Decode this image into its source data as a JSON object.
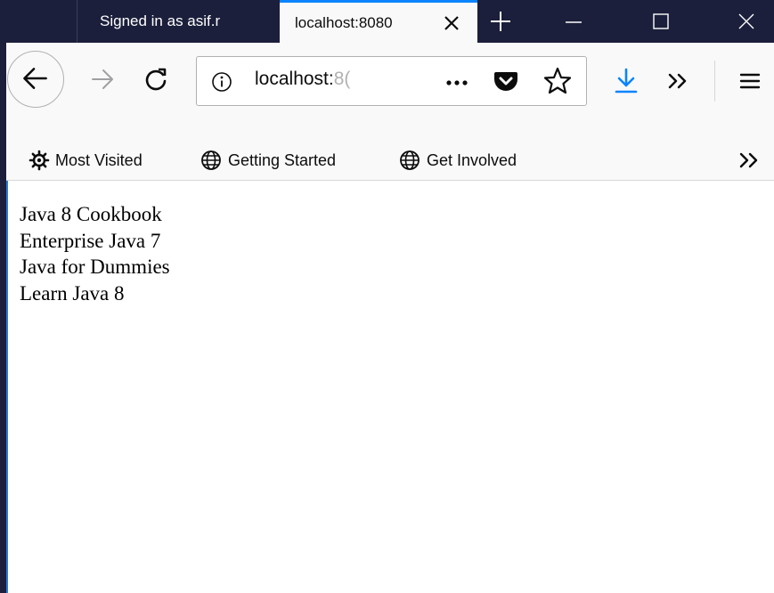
{
  "tabs": [
    {
      "title": "Signed in as asif.r",
      "active": false
    },
    {
      "title": "localhost:8080",
      "active": true
    }
  ],
  "url": {
    "visible": "localhost:",
    "faded": "8("
  },
  "bookmarks": {
    "items": [
      {
        "label": "Most Visited",
        "icon": "gear-icon"
      },
      {
        "label": "Getting Started",
        "icon": "globe-icon"
      },
      {
        "label": "Get Involved",
        "icon": "globe-icon"
      }
    ]
  },
  "content": {
    "books": [
      "Java 8 Cookbook",
      "Enterprise Java 7",
      "Java for Dummies",
      "Learn Java 8"
    ]
  },
  "colors": {
    "titlebar": "#1b1f3b",
    "accent": "#0a84ff",
    "toolbar": "#f9f9fa"
  }
}
